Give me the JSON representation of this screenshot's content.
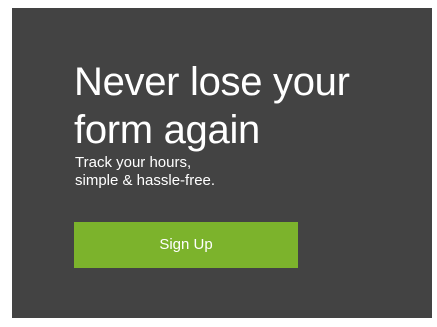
{
  "hero": {
    "headline_line1": "Never lose your",
    "headline_line2": "form again",
    "subtitle_line1": "Track your hours,",
    "subtitle_line2": "simple & hassle-free.",
    "cta_label": "Sign Up"
  },
  "colors": {
    "panel_background": "#434343",
    "cta_background": "#7cb32c",
    "text": "#ffffff"
  }
}
